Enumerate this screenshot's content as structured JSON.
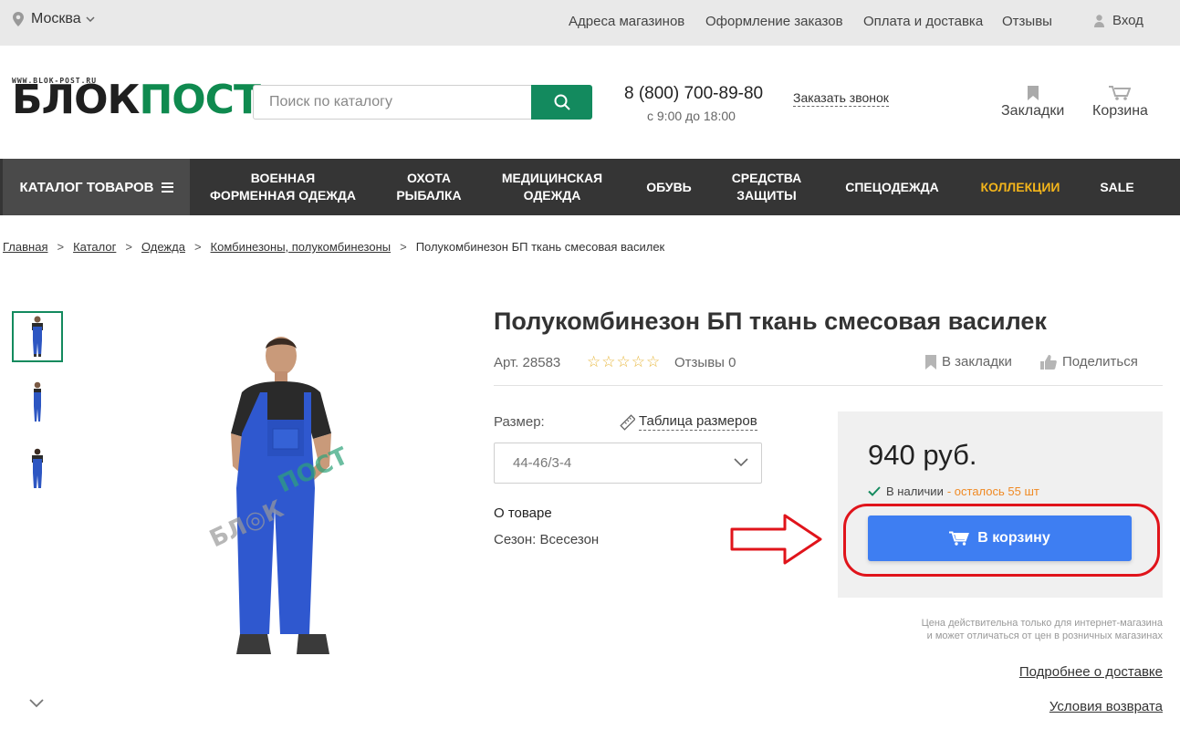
{
  "topbar": {
    "city": "Москва",
    "links": [
      "Адреса магазинов",
      "Оформление заказов",
      "Оплата и доставка",
      "Отзывы"
    ],
    "login": "Вход"
  },
  "header": {
    "logo_url": "WWW.BLOK-POST.RU",
    "logo_part1": "БЛОК",
    "logo_part2": "ПОСТ",
    "search_placeholder": "Поиск по каталогу",
    "phone": "8 (800) 700-89-80",
    "hours": "с 9:00 до 18:00",
    "callback": "Заказать звонок",
    "bookmarks": "Закладки",
    "cart": "Корзина"
  },
  "nav": {
    "catalog": "КАТАЛОГ ТОВАРОВ",
    "items": [
      {
        "line1": "ВОЕННАЯ",
        "line2": "ФОРМЕННАЯ ОДЕЖДА"
      },
      {
        "line1": "ОХОТА",
        "line2": "РЫБАЛКА"
      },
      {
        "line1": "МЕДИЦИНСКАЯ",
        "line2": "ОДЕЖДА"
      },
      {
        "line1": "ОБУВЬ",
        "line2": ""
      },
      {
        "line1": "СРЕДСТВА",
        "line2": "ЗАЩИТЫ"
      },
      {
        "line1": "СПЕЦОДЕЖДА",
        "line2": ""
      },
      {
        "line1": "КОЛЛЕКЦИИ",
        "line2": ""
      },
      {
        "line1": "SALE",
        "line2": ""
      }
    ],
    "highlight_color": "#f2b41b"
  },
  "breadcrumbs": [
    "Главная",
    "Каталог",
    "Одежда",
    "Комбинезоны, полукомбинезоны",
    "Полукомбинезон БП ткань смесовая василек"
  ],
  "product": {
    "title": "Полукомбинезон БП ткань смесовая василек",
    "article": "Арт. 28583",
    "rating_stars": "☆☆☆☆☆",
    "reviews": "Отзывы 0",
    "bookmark": "В закладки",
    "share": "Поделиться",
    "size_label": "Размер:",
    "size_table": "Таблица размеров",
    "size_selected": "44-46/3-4",
    "about": "О товаре",
    "season": "Сезон: Всесезон",
    "price": "940 руб.",
    "in_stock": "В наличии",
    "remaining": "- осталось 55 шт",
    "add_to_cart": "В корзину",
    "price_note_1": "Цена действительна только для интернет-магазина",
    "price_note_2": "и может отличаться от цен в розничных магазинах",
    "delivery_link": "Подробнее о доставке",
    "returns_link": "Условия возврата"
  },
  "colors": {
    "brand_green": "#138a5e",
    "cart_button": "#3e7ef2",
    "annotation_red": "#e0141b",
    "stock_orange": "#f08a24"
  }
}
